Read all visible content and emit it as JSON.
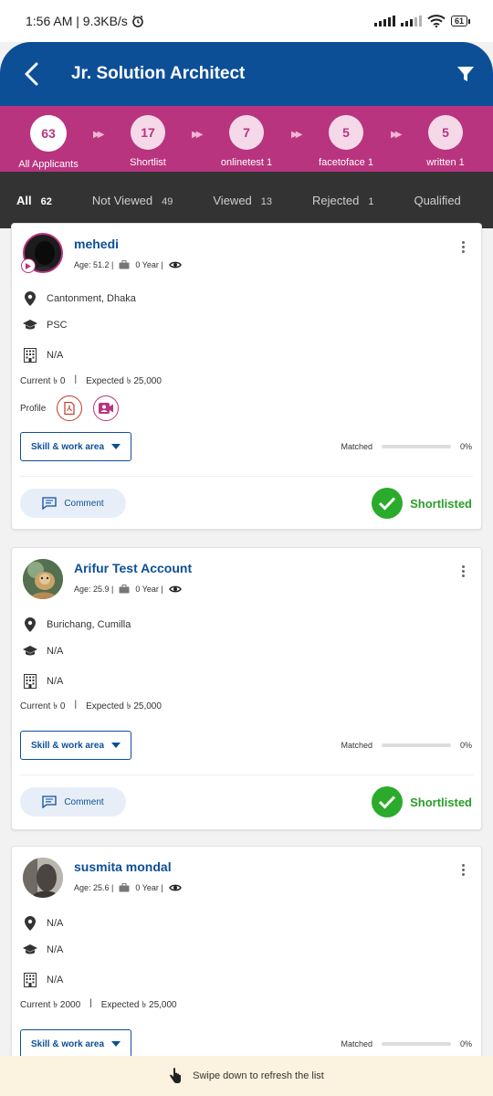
{
  "status_bar": {
    "time": "1:56 AM | 9.3KB/s",
    "battery": "61"
  },
  "header": {
    "title": "Jr. Solution Architect"
  },
  "pipeline": [
    {
      "count": "63",
      "label": "All Applicants"
    },
    {
      "count": "17",
      "label": "Shortlist"
    },
    {
      "count": "7",
      "label": "onlinetest 1"
    },
    {
      "count": "5",
      "label": "facetoface 1"
    },
    {
      "count": "5",
      "label": "written 1"
    }
  ],
  "tabs": [
    {
      "label": "All",
      "count": "62"
    },
    {
      "label": "Not Viewed",
      "count": "49"
    },
    {
      "label": "Viewed",
      "count": "13"
    },
    {
      "label": "Rejected",
      "count": "1"
    },
    {
      "label": "Qualified",
      "count": ""
    }
  ],
  "common": {
    "current_label": "Current",
    "expected_label": "Expected",
    "currency": "৳",
    "separator": "|",
    "skill_button": "Skill & work area",
    "matched_label": "Matched",
    "comment_button": "Comment",
    "profile_label": "Profile"
  },
  "applicants": [
    {
      "name": "mehedi",
      "age": "Age: 51.2 |",
      "experience": "0 Year |",
      "location": "Cantonment, Dhaka",
      "education": "PSC",
      "institution": "N/A",
      "current": "0",
      "expected": "25,000",
      "matched": "0%",
      "matched_fraction": 0,
      "status": "Shortlisted"
    },
    {
      "name": "Arifur Test Account",
      "age": "Age: 25.9 |",
      "experience": "0 Year |",
      "location": "Burichang, Cumilla",
      "education": "N/A",
      "institution": "N/A",
      "current": "0",
      "expected": "25,000",
      "matched": "0%",
      "matched_fraction": 0,
      "status": "Shortlisted"
    },
    {
      "name": "susmita mondal",
      "age": "Age: 25.6 |",
      "experience": "0 Year |",
      "location": "N/A",
      "education": "N/A",
      "institution": "N/A",
      "current": "2000",
      "expected": "25,000",
      "matched": "0%",
      "matched_fraction": 0
    }
  ],
  "toast": {
    "message": "Swipe down to refresh the list"
  },
  "colors": {
    "brand_blue": "#0d4f97",
    "pipeline_magenta": "#b8347f",
    "tab_bar": "#333333",
    "shortlisted_green": "#2bab2b"
  }
}
